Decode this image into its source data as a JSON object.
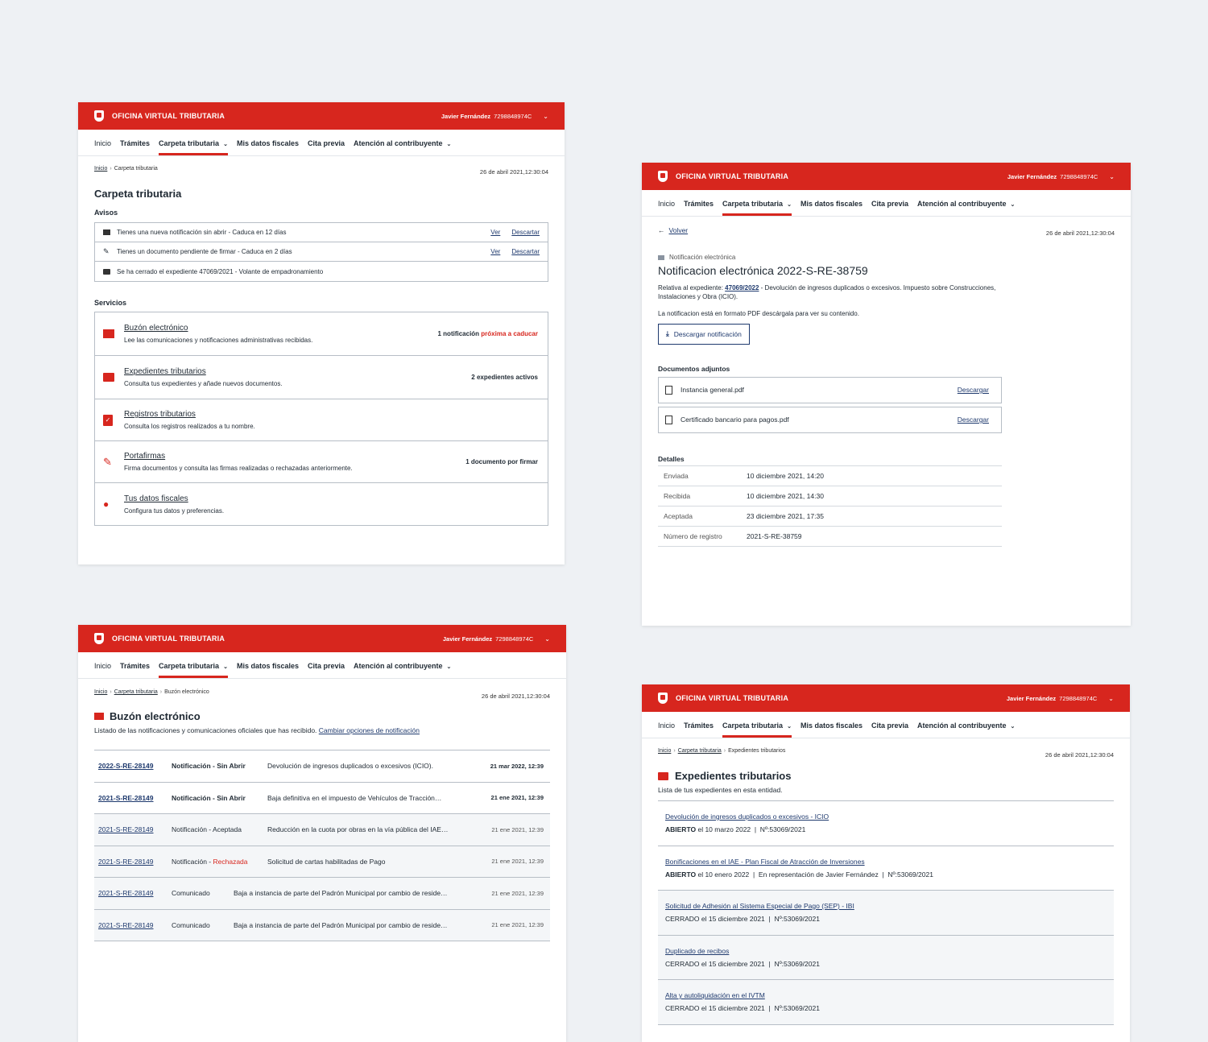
{
  "common": {
    "brand": "OFICINA VIRTUAL TRIBUTARIA",
    "user_name": "Javier Fernández",
    "user_id": "7298848974C",
    "nav": [
      "Inicio",
      "Trámites",
      "Carpeta tributaria",
      "Mis datos fiscales",
      "Cita previa",
      "Atención al contribuyente"
    ],
    "timestamp": "26 de abril 2021,12:30:04",
    "crumb_home": "Inicio",
    "crumb_carpeta": "Carpeta tributaria",
    "accent": "#d7261e"
  },
  "carpeta": {
    "title": "Carpeta tributaria",
    "avisos_title": "Avisos",
    "avisos": [
      {
        "icon": "mail-icon",
        "text": "Tienes una nueva notificación sin abrir - Caduca en 12 días",
        "ver": "Ver",
        "descartar": "Descartar"
      },
      {
        "icon": "sign-icon",
        "text": "Tienes un documento pendiente de firmar - Caduca en 2 días",
        "ver": "Ver",
        "descartar": "Descartar"
      },
      {
        "icon": "folder-icon",
        "text": "Se ha cerrado el expediente  47069/2021 - Volante de empadronamiento"
      }
    ],
    "servicios_title": "Servicios",
    "servicios": [
      {
        "icon": "mail-icon",
        "name": "Buzón electrónico",
        "desc": "Lee las comunicaciones y notificaciones administrativas recibidas.",
        "status": "1 notificación",
        "status_red": "próxima a caducar"
      },
      {
        "icon": "folder-icon",
        "name": "Expedientes tributarios",
        "desc": "Consulta tus expedientes y añade nuevos documentos.",
        "status": "2 expedientes activos",
        "status_red": ""
      },
      {
        "icon": "document-check-icon",
        "name": "Registros tributarios",
        "desc": "Consulta los registros realizados a tu nombre.",
        "status": "",
        "status_red": ""
      },
      {
        "icon": "pen-icon",
        "name": "Portafirmas",
        "desc": "Firma documentos y consulta las firmas realizadas o rechazadas anteriormente.",
        "status": "1 documento por firmar",
        "status_red": ""
      },
      {
        "icon": "person-icon",
        "name": "Tus datos fiscales",
        "desc": "Configura tus datos y preferencias.",
        "status": "",
        "status_red": ""
      }
    ]
  },
  "notificacion": {
    "back": "Volver",
    "kind": "Notificación electrónica",
    "title": "Notificacion electrónica 2022-S-RE-38759",
    "rel_prefix": "Relativa al expediente: ",
    "rel_link": "47069/2022",
    "rel_text": " - Devolución de ingresos duplicados o excesivos. Impuesto sobre Construcciones, Instalaciones y Obra (ICIO).",
    "pdf_note": "La notificacion está en formato PDF descárgala para ver su contenido.",
    "download_btn": "Descargar notificación",
    "adjuntos_title": "Documentos adjuntos",
    "adjuntos": [
      {
        "name": "Instancia general.pdf",
        "action": "Descargar"
      },
      {
        "name": "Certificado bancario para pagos.pdf",
        "action": "Descargar"
      }
    ],
    "detalles_title": "Detalles",
    "detalles": [
      {
        "label": "Enviada",
        "value": "10 diciembre 2021, 14:20"
      },
      {
        "label": "Recibida",
        "value": "10 diciembre 2021, 14:30"
      },
      {
        "label": "Aceptada",
        "value": "23 diciembre 2021, 17:35"
      },
      {
        "label": "Número de registro",
        "value": "2021-S-RE-38759"
      }
    ]
  },
  "buzon": {
    "crumb_current": "Buzón electrónico",
    "title": "Buzón electrónico",
    "intro": "Listado de las notificaciones y comunicaciones oficiales que has recibido. ",
    "intro_link": "Cambiar opciones de notificación",
    "rows": [
      {
        "id": "2022-S-RE-28149",
        "type": "Notificación - Sin Abrir",
        "type_red": "",
        "desc": "Devolución de ingresos duplicados o excesivos (ICIO).",
        "date": "21 mar 2022, 12:39",
        "bold": true
      },
      {
        "id": "2021-S-RE-28149",
        "type": "Notificación - Sin Abrir",
        "type_red": "",
        "desc": "Baja definitiva en el impuesto de Vehículos de Tracción…",
        "date": "21 ene 2021, 12:39",
        "bold": true
      },
      {
        "id": "2021-S-RE-28149",
        "type": "Notificación - Aceptada",
        "type_red": "",
        "desc": "Reducción en la cuota por obras en la vía pública del IAE…",
        "date": "21 ene 2021, 12:39",
        "bold": false
      },
      {
        "id": "2021-S-RE-28149",
        "type": "Notificación - ",
        "type_red": "Rechazada",
        "desc": "Solicitud de cartas habilitadas de Pago",
        "date": "21 ene 2021, 12:39",
        "bold": false
      },
      {
        "id": "2021-S-RE-28149",
        "type": "Comunicado",
        "type_red": "",
        "desc": "Baja a instancia de parte del Padrón Municipal por cambio de reside…",
        "date": "21 ene 2021, 12:39",
        "bold": false
      },
      {
        "id": "2021-S-RE-28149",
        "type": "Comunicado",
        "type_red": "",
        "desc": "Baja a instancia de parte del Padrón Municipal por cambio de reside…",
        "date": "21 ene 2021, 12:39",
        "bold": false
      }
    ]
  },
  "expedientes": {
    "crumb_current": "Expedientes tributarios",
    "title": "Expedientes tributarios",
    "intro": "Lista de tus expedientes en esta entidad.",
    "items": [
      {
        "name": "Devolución de ingresos duplicados o excesivos - ICIO",
        "status": "ABIERTO",
        "meta": " el 10 marzo 2022  |  Nº:53069/2021",
        "open": true
      },
      {
        "name": "Bonificaciones en el IAE - Plan Fiscal de Atracción de Inversiones",
        "status": "ABIERTO",
        "meta": " el 10 enero 2022  |  En representación de Javier Fernández  |  Nº:53069/2021",
        "open": true
      },
      {
        "name": "Solicitud de Adhesión al Sistema Especial de Pago (SEP) - IBI",
        "status": "CERRADO",
        "meta": " el 15 diciembre 2021  |  Nº:53069/2021",
        "open": false
      },
      {
        "name": "Duplicado de recibos",
        "status": "CERRADO",
        "meta": " el 15 diciembre 2021  |  Nº:53069/2021",
        "open": false
      },
      {
        "name": "Alta y autoliquidación en el IVTM",
        "status": "CERRADO",
        "meta": " el 15 diciembre 2021  |  Nº:53069/2021",
        "open": false
      }
    ]
  }
}
